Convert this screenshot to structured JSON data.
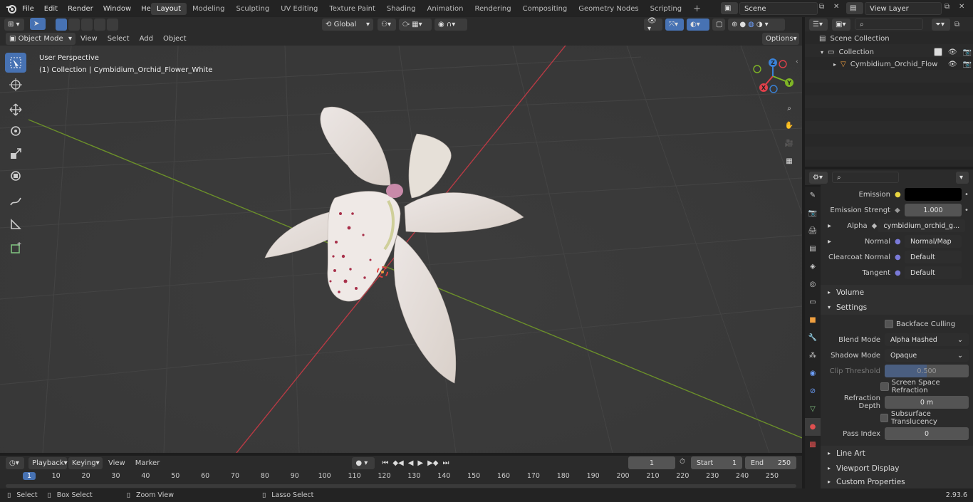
{
  "menu": [
    "File",
    "Edit",
    "Render",
    "Window",
    "Help"
  ],
  "workspaces": [
    {
      "label": "Layout",
      "active": true
    },
    {
      "label": "Modeling"
    },
    {
      "label": "Sculpting"
    },
    {
      "label": "UV Editing"
    },
    {
      "label": "Texture Paint"
    },
    {
      "label": "Shading"
    },
    {
      "label": "Animation"
    },
    {
      "label": "Rendering"
    },
    {
      "label": "Compositing"
    },
    {
      "label": "Geometry Nodes"
    },
    {
      "label": "Scripting"
    }
  ],
  "scene": "Scene",
  "view_layer": "View Layer",
  "header": {
    "mode": "Object Mode",
    "menus": [
      "View",
      "Select",
      "Add",
      "Object"
    ],
    "orientation": "Global",
    "options": "Options"
  },
  "viewport": {
    "perspective": "User Perspective",
    "collection_info": "(1) Collection | Cymbidium_Orchid_Flower_White"
  },
  "gizmo": {
    "x": "X",
    "y": "Y",
    "z": "Z"
  },
  "outliner": {
    "root": "Scene Collection",
    "collection": "Collection",
    "object": "Cymbidium_Orchid_Flow"
  },
  "properties": {
    "rows1": [
      {
        "label": "Emission",
        "value": "",
        "kind": "color"
      },
      {
        "label": "Emission Strengt",
        "value": "1.000",
        "kind": "num"
      },
      {
        "label": "Alpha",
        "value": "cymbidium_orchid_g...",
        "kind": "link"
      },
      {
        "label": "Normal",
        "value": "Normal/Map",
        "kind": "link"
      },
      {
        "label": "Clearcoat Normal",
        "value": "Default",
        "kind": "link"
      },
      {
        "label": "Tangent",
        "value": "Default",
        "kind": "link"
      }
    ],
    "volume": "Volume",
    "settings": "Settings",
    "backface": "Backface Culling",
    "blend_label": "Blend Mode",
    "blend_value": "Alpha Hashed",
    "shadow_label": "Shadow Mode",
    "shadow_value": "Opaque",
    "clip_label": "Clip Threshold",
    "clip_value": "0.500",
    "clip_fraction": 0.5,
    "ssr": "Screen Space Refraction",
    "refr_label": "Refraction Depth",
    "refr_value": "0 m",
    "sst": "Subsurface Translucency",
    "pass_label": "Pass Index",
    "pass_value": "0",
    "line_art": "Line Art",
    "viewport_display": "Viewport Display",
    "custom_props": "Custom Properties"
  },
  "timeline": {
    "menus": [
      "Playback",
      "Keying",
      "View",
      "Marker"
    ],
    "current": "1",
    "start_label": "Start",
    "start": "1",
    "end_label": "End",
    "end": "250",
    "ticks": [
      "1",
      "10",
      "20",
      "30",
      "40",
      "50",
      "60",
      "70",
      "80",
      "90",
      "100",
      "110",
      "120",
      "130",
      "140",
      "150",
      "160",
      "170",
      "180",
      "190",
      "200",
      "210",
      "220",
      "230",
      "240",
      "250"
    ]
  },
  "status": {
    "select": "Select",
    "box": "Box Select",
    "zoom": "Zoom View",
    "lasso": "Lasso Select",
    "version": "2.93.6"
  },
  "colors": {
    "accent": "#4772b3",
    "x_axis": "#e0404a",
    "y_axis": "#7fb526",
    "z_axis": "#3a82d8"
  }
}
